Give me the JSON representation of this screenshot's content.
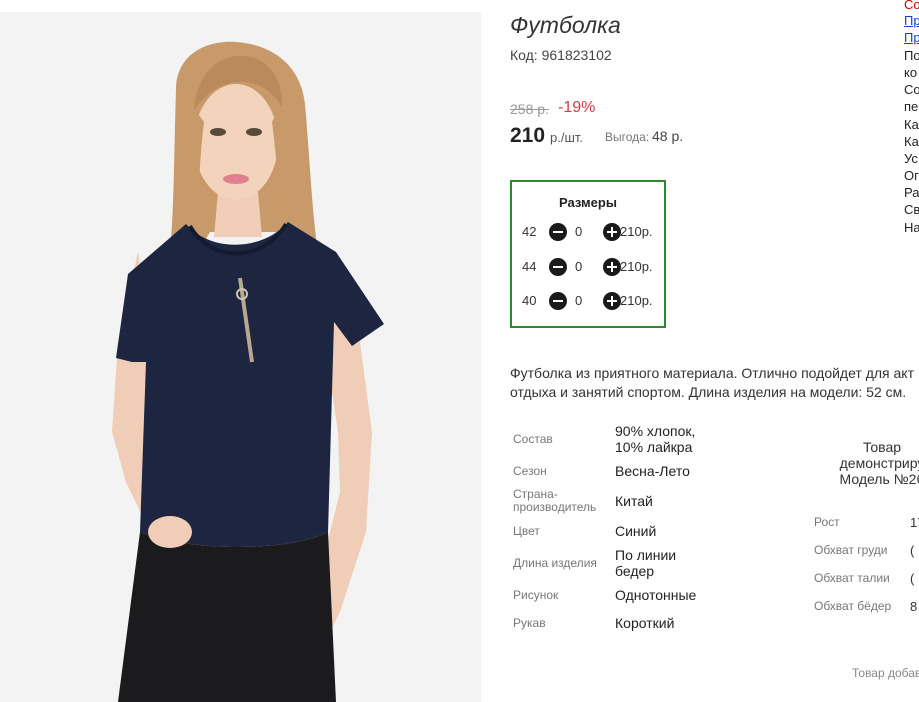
{
  "product": {
    "title": "Футболка",
    "code": "Код: 961823102",
    "old_price": "258 р.",
    "discount": "-19%",
    "price": "210",
    "price_unit": "р./шт.",
    "benefit_label": "Выгода:",
    "benefit_value": "48 р."
  },
  "sizes": {
    "title": "Размеры",
    "rows": [
      {
        "size": "42",
        "qty": "0",
        "price": "210р."
      },
      {
        "size": "44",
        "qty": "0",
        "price": "210р."
      },
      {
        "size": "40",
        "qty": "0",
        "price": "210р."
      }
    ]
  },
  "description": {
    "line1": "Футболка из приятного материала. Отлично подойдет для акт",
    "line2": "отдыха и занятий спортом. Длина изделия на модели: 52 см."
  },
  "specs": [
    {
      "label": "Состав",
      "value": "90% хлопок,\n10% лайкра"
    },
    {
      "label": "Сезон",
      "value": "Весна-Лето"
    },
    {
      "label": "Страна-\nпроизводитель",
      "value": "Китай"
    },
    {
      "label": "Цвет",
      "value": "Синий"
    },
    {
      "label": "Длина изделия",
      "value": "По линии\nбедер"
    },
    {
      "label": "Рисунок",
      "value": "Однотонные"
    },
    {
      "label": "Рукав",
      "value": "Короткий"
    }
  ],
  "model": {
    "head_line1": "Товар",
    "head_line2": "демонстриру",
    "head_line3": "Модель №2б",
    "rows": [
      {
        "label": "Рост",
        "value": "17"
      },
      {
        "label": "Обхват груди",
        "value": "("
      },
      {
        "label": "Обхват талии",
        "value": "("
      },
      {
        "label": "Обхват бёдер",
        "value": "8"
      }
    ]
  },
  "added_note": "Товар добав",
  "side_links": [
    {
      "text": "Со",
      "color": "#cc0000"
    },
    {
      "text": "Пр",
      "color": "#1a3fcc"
    },
    {
      "text": "Пр",
      "color": "#1a3fcc"
    },
    {
      "text": "По",
      "color": "#222222"
    },
    {
      "text": "ко",
      "color": "#222222"
    },
    {
      "text": "Со",
      "color": "#222222"
    },
    {
      "text": "пе",
      "color": "#222222"
    },
    {
      "text": "Ка",
      "color": "#222222"
    },
    {
      "text": "Ка",
      "color": "#222222"
    },
    {
      "text": "Ус",
      "color": "#222222"
    },
    {
      "text": "Ог",
      "color": "#222222"
    },
    {
      "text": "Ра",
      "color": "#222222"
    },
    {
      "text": "Св",
      "color": "#222222"
    },
    {
      "text": "На",
      "color": "#222222"
    }
  ],
  "colors": {
    "discount": "#d8384a",
    "sizes_border": "#2d8a2d",
    "shirt": "#1d2540",
    "jeans": "#1b1b1e"
  }
}
